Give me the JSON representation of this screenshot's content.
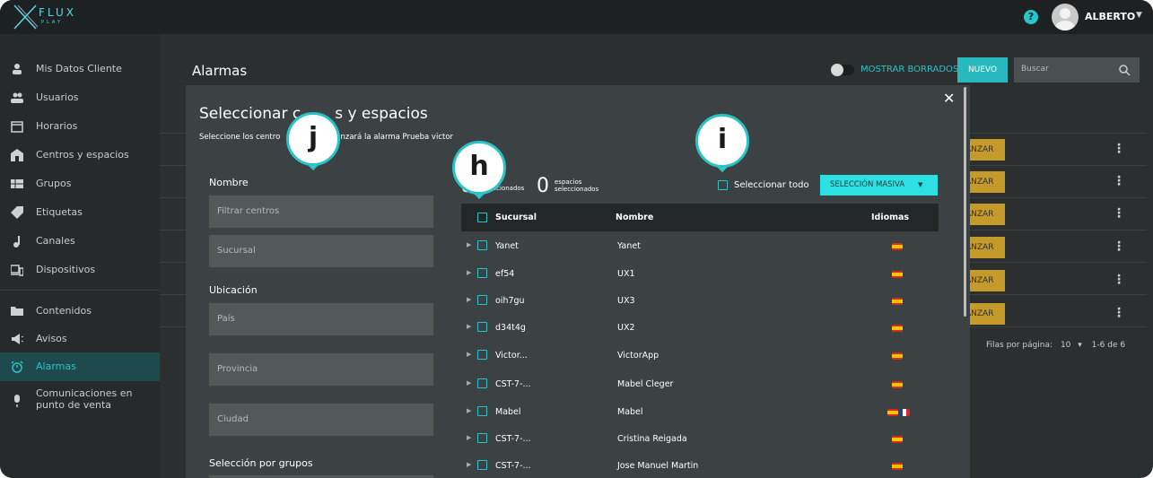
{
  "brand": {
    "name": "FLUX",
    "tagline": "PLAY"
  },
  "header": {
    "user": "ALBERTO"
  },
  "sidebar": {
    "items": [
      {
        "label": "Mis Datos Cliente",
        "icon": "person-icon"
      },
      {
        "label": "Usuarios",
        "icon": "users-icon"
      },
      {
        "label": "Horarios",
        "icon": "calendar-icon"
      },
      {
        "label": "Centros y espacios",
        "icon": "store-icon"
      },
      {
        "label": "Grupos",
        "icon": "grid-icon"
      },
      {
        "label": "Etiquetas",
        "icon": "tag-icon"
      },
      {
        "label": "Canales",
        "icon": "music-note-icon"
      },
      {
        "label": "Dispositivos",
        "icon": "devices-icon"
      },
      {
        "label": "Contenidos",
        "icon": "folder-icon"
      },
      {
        "label": "Avisos",
        "icon": "megaphone-icon"
      },
      {
        "label": "Alarmas",
        "icon": "alarm-icon"
      },
      {
        "label": "Comunicaciones en punto de venta",
        "icon": "microphone-icon"
      }
    ],
    "active": "Alarmas"
  },
  "main": {
    "title": "Alarmas",
    "toggle_label": "MOSTRAR BORRADOS",
    "new_button": "NUEVO",
    "search_placeholder": "Buscar",
    "row_button": "ANZAR",
    "pager_label": "Filas por página:",
    "pager_size": "10",
    "pager_range": "1-6 de 6"
  },
  "modal": {
    "title_part1": "Seleccionar c",
    "title_part2": "s y espacios",
    "subtitle_part1": "Seleccione los centro",
    "subtitle_part2": "anzará la alarma Prueba victor",
    "filters": {
      "name_label": "Nombre",
      "filter_centers_placeholder": "Filtrar centros",
      "branch_placeholder": "Sucursal",
      "location_label": "Ubicación",
      "country_placeholder": "País",
      "province_placeholder": "Provincia",
      "city_placeholder": "Ciudad",
      "groups_label": "Selección por grupos"
    },
    "counts": {
      "centers_count": "0",
      "centers_label": "eccionados",
      "spaces_count": "0",
      "spaces_label_1": "espacios",
      "spaces_label_2": "seleccionados"
    },
    "select_all": "Seleccionar todo",
    "bulk_selection": "SELECCIÓN MASIVA",
    "table": {
      "columns": [
        "Sucursal",
        "Nombre",
        "Idiomas"
      ],
      "rows": [
        {
          "sucursal": "Yanet",
          "nombre": "Yanet",
          "flags": [
            "es"
          ]
        },
        {
          "sucursal": "ef54",
          "nombre": "UX1",
          "flags": [
            "es"
          ]
        },
        {
          "sucursal": "oih7gu",
          "nombre": "UX3",
          "flags": [
            "es"
          ]
        },
        {
          "sucursal": "d34t4g",
          "nombre": "UX2",
          "flags": [
            "es"
          ]
        },
        {
          "sucursal": "Victor...",
          "nombre": "VictorApp",
          "flags": [
            "es"
          ]
        },
        {
          "sucursal": "CST-7-...",
          "nombre": "Mabel Cleger",
          "flags": [
            "es"
          ]
        },
        {
          "sucursal": "Mabel",
          "nombre": "Mabel",
          "flags": [
            "es",
            "fr"
          ]
        },
        {
          "sucursal": "CST-7-...",
          "nombre": "Cristina Reigada",
          "flags": [
            "es"
          ]
        },
        {
          "sucursal": "CST-7-...",
          "nombre": "Jose Manuel Martin",
          "flags": [
            "es"
          ]
        }
      ]
    }
  },
  "callouts": [
    "j",
    "h",
    "i"
  ],
  "colors": {
    "accent": "#2ac3c7",
    "warning": "#c49a2a",
    "background": "#2b2f30"
  }
}
